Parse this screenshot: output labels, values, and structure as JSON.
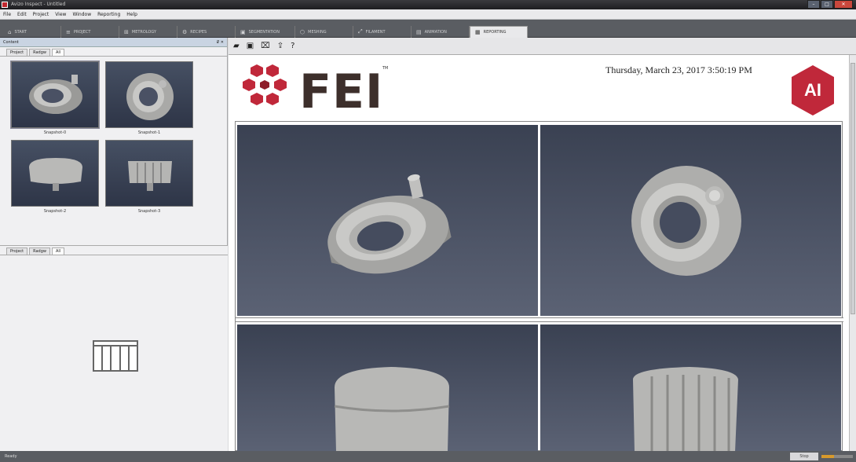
{
  "window": {
    "title": "Avizo Inspect - Untitled"
  },
  "menu": [
    "File",
    "Edit",
    "Project",
    "View",
    "Window",
    "Reporting",
    "Help"
  ],
  "workspaces": [
    {
      "label": "START",
      "icon": "⌂"
    },
    {
      "label": "PROJECT",
      "icon": "≡"
    },
    {
      "label": "METROLOGY",
      "icon": "⊞"
    },
    {
      "label": "RECIPES",
      "icon": "⚙"
    },
    {
      "label": "SEGMENTATION",
      "icon": "▣"
    },
    {
      "label": "MESHING",
      "icon": "⬡"
    },
    {
      "label": "FILAMENT",
      "icon": "⤢"
    },
    {
      "label": "ANIMATION",
      "icon": "▤"
    },
    {
      "label": "REPORTING",
      "icon": "▦"
    }
  ],
  "active_workspace": "REPORTING",
  "content_panel": {
    "title": "Content",
    "controls": "₽ ✕",
    "tabs": [
      "Project",
      "Radgw",
      "All"
    ],
    "snapshots": [
      "Snapshot-0",
      "Snapshot-1",
      "Snapshot-2",
      "Snapshot-3"
    ]
  },
  "lower_panel": {
    "tabs": [
      "Project",
      "Radgw",
      "All"
    ]
  },
  "toolbar": {
    "icons": [
      "open-folder-icon",
      "save-icon",
      "delete-icon",
      "export-icon",
      "help-icon"
    ],
    "help_label": "?"
  },
  "report": {
    "brand": "FEI",
    "trademark": "TM",
    "datetime": "Thursday, March 23, 2017 3:50:19 PM",
    "badge": "AI",
    "colors": {
      "brand_red": "#c0283a",
      "brand_text": "#3d2f2b"
    }
  },
  "status": {
    "text": "Ready",
    "button": "Stop",
    "progress": 0.4
  }
}
